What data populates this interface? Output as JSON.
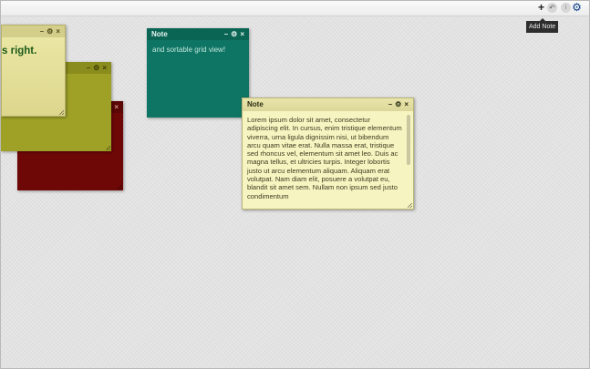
{
  "toolbar": {
    "add_label": "+",
    "undo_label": "↶",
    "info_label": "i",
    "settings_label": "⚙",
    "tooltip": "Add Note"
  },
  "colors": {
    "red": "#6e0807",
    "olive": "#9ea126",
    "yellow": "#ece9a7",
    "teal": "#0e7463",
    "main": "#f6f4c0"
  },
  "notes": {
    "yellow_top": {
      "title": "",
      "controls": [
        "–",
        "⚙",
        "×"
      ],
      "text": "s right."
    },
    "olive": {
      "title": "",
      "controls": [
        "–",
        "⚙",
        "×"
      ]
    },
    "red": {
      "title": "",
      "controls": [
        "–",
        "⚙",
        "×"
      ]
    },
    "teal": {
      "title": "Note",
      "controls": [
        "–",
        "⚙",
        "×"
      ],
      "text": "and sortable grid view!"
    },
    "main": {
      "title": "Note",
      "controls": [
        "–",
        "⚙",
        "×"
      ],
      "text": "Lorem ipsum dolor sit amet, consectetur adipiscing elit. In cursus, enim tristique elementum viverra, urna ligula dignissim nisi, ut bibendum arcu quam vitae erat. Nulla massa erat, tristique sed rhoncus vel, elementum sit amet leo. Duis ac magna tellus, et ultricies turpis. Integer lobortis justo ut arcu elementum aliquam. Aliquam erat volutpat. Nam diam elit, posuere a volutpat eu, blandit sit amet sem. Nullam non ipsum sed justo condimentum"
    }
  }
}
